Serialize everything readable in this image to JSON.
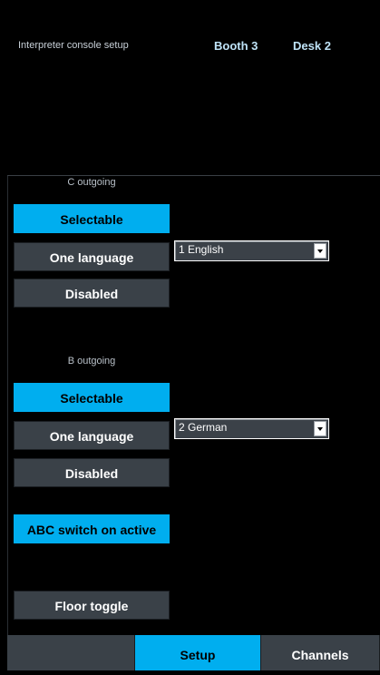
{
  "header": {
    "title": "Interpreter console setup",
    "booth": "Booth 3",
    "desk": "Desk 2"
  },
  "c_outgoing": {
    "label": "C outgoing",
    "selectable": "Selectable",
    "one_language": "One language",
    "disabled": "Disabled",
    "selected_mode": "Selectable",
    "language": "1 English"
  },
  "b_outgoing": {
    "label": "B outgoing",
    "selectable": "Selectable",
    "one_language": "One language",
    "disabled": "Disabled",
    "selected_mode": "Selectable",
    "language": "2 German"
  },
  "abc_switch": {
    "label": "ABC switch on active",
    "active": true
  },
  "floor_toggle": {
    "label": "Floor toggle"
  },
  "tabs": [
    {
      "label": "",
      "active": false
    },
    {
      "label": "Setup",
      "active": true
    },
    {
      "label": "Channels",
      "active": false
    }
  ],
  "colors": {
    "background": "#000000",
    "accent": "#00aeef",
    "button": "#3a4148",
    "header_value": "#bfe3f7"
  }
}
